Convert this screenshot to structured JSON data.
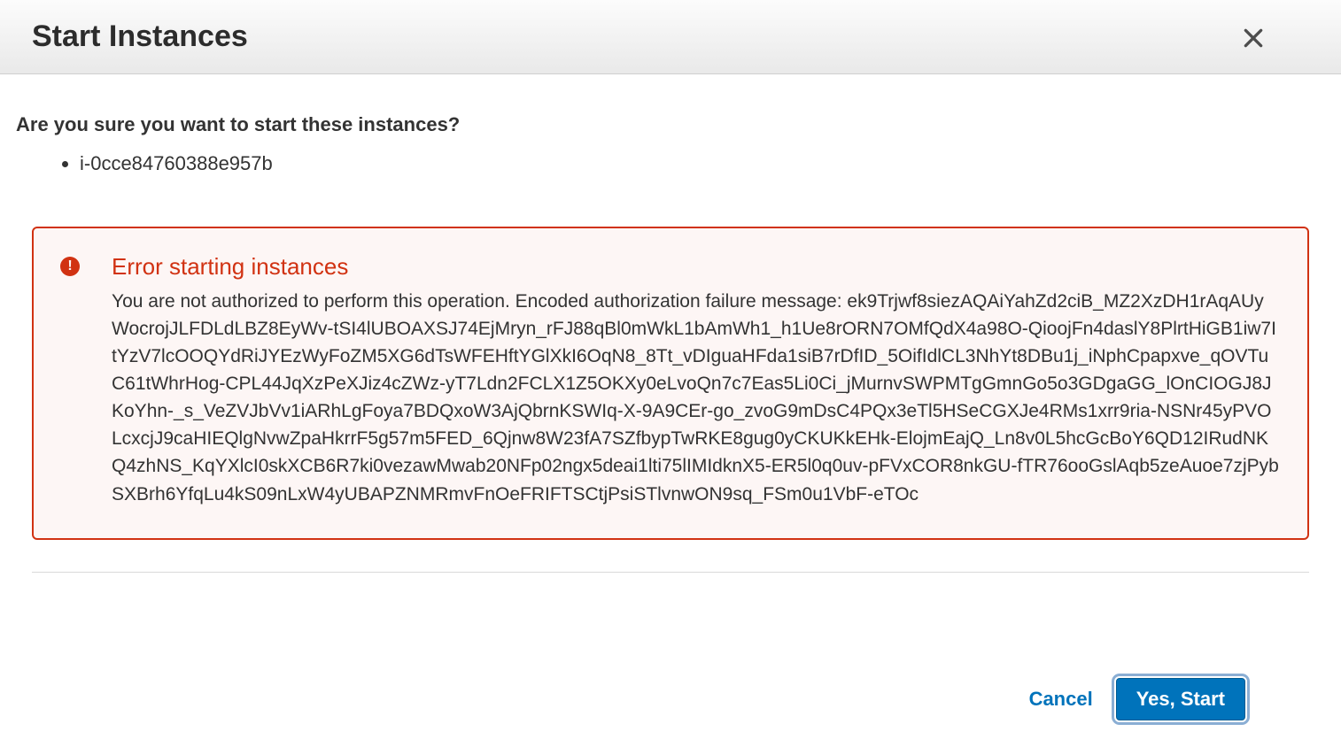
{
  "dialog": {
    "title": "Start Instances",
    "confirm_question": "Are you sure you want to start these instances?"
  },
  "instances": [
    "i-0cce84760388e957b"
  ],
  "error": {
    "title": "Error starting instances",
    "message": "You are not authorized to perform this operation. Encoded authorization failure message: ek9Trjwf8siezAQAiYahZd2ciB_MZ2XzDH1rAqAUyWocrojJLFDLdLBZ8EyWv-tSI4lUBOAXSJ74EjMryn_rFJ88qBl0mWkL1bAmWh1_h1Ue8rORN7OMfQdX4a98O-QioojFn4daslY8PlrtHiGB1iw7ItYzV7lcOOQYdRiJYEzWyFoZM5XG6dTsWFEHftYGlXkI6OqN8_8Tt_vDIguaHFda1siB7rDfID_5OifIdlCL3NhYt8DBu1j_iNphCpapxve_qOVTuC61tWhrHog-CPL44JqXzPeXJiz4cZWz-yT7Ldn2FCLX1Z5OKXy0eLvoQn7c7Eas5Li0Ci_jMurnvSWPMTgGmnGo5o3GDgaGG_lOnCIOGJ8JKoYhn-_s_VeZVJbVv1iARhLgFoya7BDQxoW3AjQbrnKSWIq-X-9A9CEr-go_zvoG9mDsC4PQx3eTl5HSeCGXJe4RMs1xrr9ria-NSNr45yPVOLcxcjJ9caHIEQlgNvwZpaHkrrF5g57m5FED_6Qjnw8W23fA7SZfbypTwRKE8gug0yCKUKkEHk-ElojmEajQ_Ln8v0L5hcGcBoY6QD12IRudNKQ4zhNS_KqYXlcI0skXCB6R7ki0vezawMwab20NFp02ngx5deai1lti75lIMIdknX5-ER5l0q0uv-pFVxCOR8nkGU-fTR76ooGslAqb5zeAuoe7zjPybSXBrh6YfqLu4kS09nLxW4yUBAPZNMRmvFnOeFRIFTSCtjPsiSTlvnwON9sq_FSm0u1VbF-eTOc"
  },
  "footer": {
    "cancel_label": "Cancel",
    "confirm_label": "Yes, Start"
  },
  "colors": {
    "error_border": "#d13212",
    "error_bg": "#fdf6f5",
    "primary_button": "#0073bb",
    "link": "#0073bb"
  }
}
